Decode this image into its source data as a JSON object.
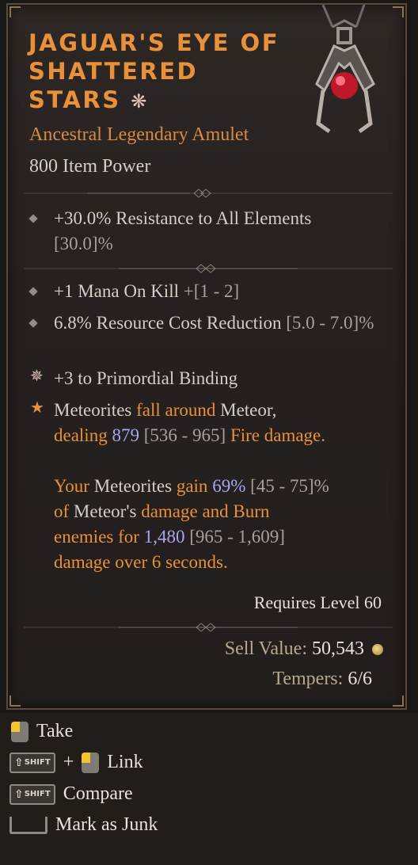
{
  "item": {
    "name": "Jaguar's Eye of Shattered Stars",
    "name_glyph": "❋",
    "type": "Ancestral Legendary Amulet",
    "power": "800 Item Power"
  },
  "stats": {
    "implicit": {
      "text": "+30.0% Resistance to All Elements",
      "range": "[30.0]%"
    },
    "mana": {
      "text": "+1 Mana On Kill",
      "range": "+[1 - 2]"
    },
    "resource": {
      "text": "6.8% Resource Cost Reduction",
      "range": "[5.0 - 7.0]%"
    },
    "binding": {
      "text": "+3 to Primordial Binding"
    }
  },
  "aspect": {
    "l1a": "Meteorites",
    "l1b": "fall around",
    "l1c": "Meteor,",
    "l2a": "dealing",
    "l2b": "879",
    "l2c": "[536 - 965]",
    "l2d": "Fire damage.",
    "l3a": "Your",
    "l3b": "Meteorites",
    "l3c": "gain",
    "l3d": "69%",
    "l3e": "[45 - 75]%",
    "l4a": "of",
    "l4b": "Meteor's",
    "l4c": "damage and Burn",
    "l5a": "enemies for",
    "l5b": "1,480",
    "l5c": "[965 - 1,609]",
    "l6a": "damage over 6 seconds."
  },
  "requirements": "Requires Level 60",
  "sell": {
    "label": "Sell Value:",
    "value": "50,543"
  },
  "tempers": {
    "label": "Tempers:",
    "value": "6/6"
  },
  "actions": {
    "take": "Take",
    "link": "Link",
    "compare": "Compare",
    "junk": "Mark as Junk",
    "shift_key": "SHIFT",
    "plus": "+"
  },
  "colors": {
    "legendary": "#e8913a",
    "stat": "#d4cec6",
    "value_blue": "#a8a6f2",
    "range_gray": "#a7a19a"
  }
}
